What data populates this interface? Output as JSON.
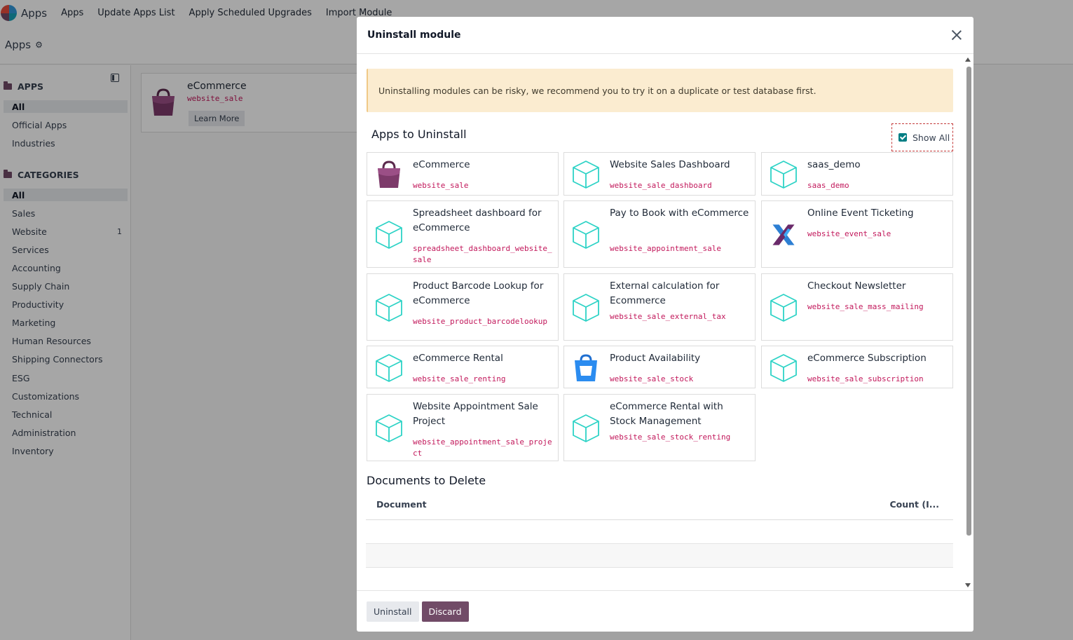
{
  "topnav": {
    "app_name": "Apps",
    "items": [
      "Apps",
      "Update Apps List",
      "Apply Scheduled Upgrades",
      "Import Module"
    ]
  },
  "control_panel": {
    "title": "Apps"
  },
  "sidebar": {
    "apps_header": "APPS",
    "apps_items": [
      "All",
      "Official Apps",
      "Industries"
    ],
    "categories_header": "CATEGORIES",
    "categories": [
      {
        "label": "All",
        "count": ""
      },
      {
        "label": "Sales",
        "count": ""
      },
      {
        "label": "Website",
        "count": "1"
      },
      {
        "label": "Services",
        "count": ""
      },
      {
        "label": "Accounting",
        "count": ""
      },
      {
        "label": "Supply Chain",
        "count": ""
      },
      {
        "label": "Productivity",
        "count": ""
      },
      {
        "label": "Marketing",
        "count": ""
      },
      {
        "label": "Human Resources",
        "count": ""
      },
      {
        "label": "Shipping Connectors",
        "count": ""
      },
      {
        "label": "ESG",
        "count": ""
      },
      {
        "label": "Customizations",
        "count": ""
      },
      {
        "label": "Technical",
        "count": ""
      },
      {
        "label": "Administration",
        "count": ""
      },
      {
        "label": "Inventory",
        "count": ""
      }
    ]
  },
  "kanban": {
    "name": "eCommerce",
    "technical": "website_sale",
    "button": "Learn More"
  },
  "modal": {
    "title": "Uninstall module",
    "warning": "Uninstalling modules can be risky, we recommend you to try it on a duplicate or test database first.",
    "apps_title": "Apps to Uninstall",
    "show_all_label": "Show All",
    "show_all_checked": true,
    "modules": [
      {
        "name": "eCommerce",
        "technical": "website_sale",
        "icon": "ecommerce-bag-icon"
      },
      {
        "name": "Website Sales Dashboard",
        "technical": "website_sale_dashboard",
        "icon": "module-cube-icon"
      },
      {
        "name": "saas_demo",
        "technical": "saas_demo",
        "icon": "module-cube-icon"
      },
      {
        "name": "Spreadsheet dashboard for eCommerce",
        "technical": "spreadsheet_dashboard_website_sale",
        "icon": "module-cube-icon"
      },
      {
        "name": "Pay to Book with eCommerce",
        "technical": "website_appointment_sale",
        "icon": "module-cube-icon"
      },
      {
        "name": "Online Event Ticketing",
        "technical": "website_event_sale",
        "icon": "event-ticketing-icon"
      },
      {
        "name": "Product Barcode Lookup for eCommerce",
        "technical": "website_product_barcodelookup",
        "icon": "module-cube-icon"
      },
      {
        "name": "External calculation for Ecommerce",
        "technical": "website_sale_external_tax",
        "icon": "module-cube-icon"
      },
      {
        "name": "Checkout Newsletter",
        "technical": "website_sale_mass_mailing",
        "icon": "module-cube-icon"
      },
      {
        "name": "eCommerce Rental",
        "technical": "website_sale_renting",
        "icon": "module-cube-icon"
      },
      {
        "name": "Product Availability",
        "technical": "website_sale_stock",
        "icon": "inventory-box-icon"
      },
      {
        "name": "eCommerce Subscription",
        "technical": "website_sale_subscription",
        "icon": "module-cube-icon"
      },
      {
        "name": "Website Appointment Sale Project",
        "technical": "website_appointment_sale_project",
        "icon": "module-cube-icon"
      },
      {
        "name": "eCommerce Rental with Stock Management",
        "technical": "website_sale_stock_renting",
        "icon": "module-cube-icon"
      }
    ],
    "documents_title": "Documents to Delete",
    "documents_columns": [
      "Document",
      "Count (I..."
    ],
    "documents_rows": [],
    "uninstall_label": "Uninstall",
    "discard_label": "Discard"
  },
  "colors": {
    "brand": "#714B67",
    "checkbox": "#017e84",
    "cube": "#2ed3c6",
    "technical_text": "#c2185b",
    "warning_bg": "#fbecd0"
  }
}
